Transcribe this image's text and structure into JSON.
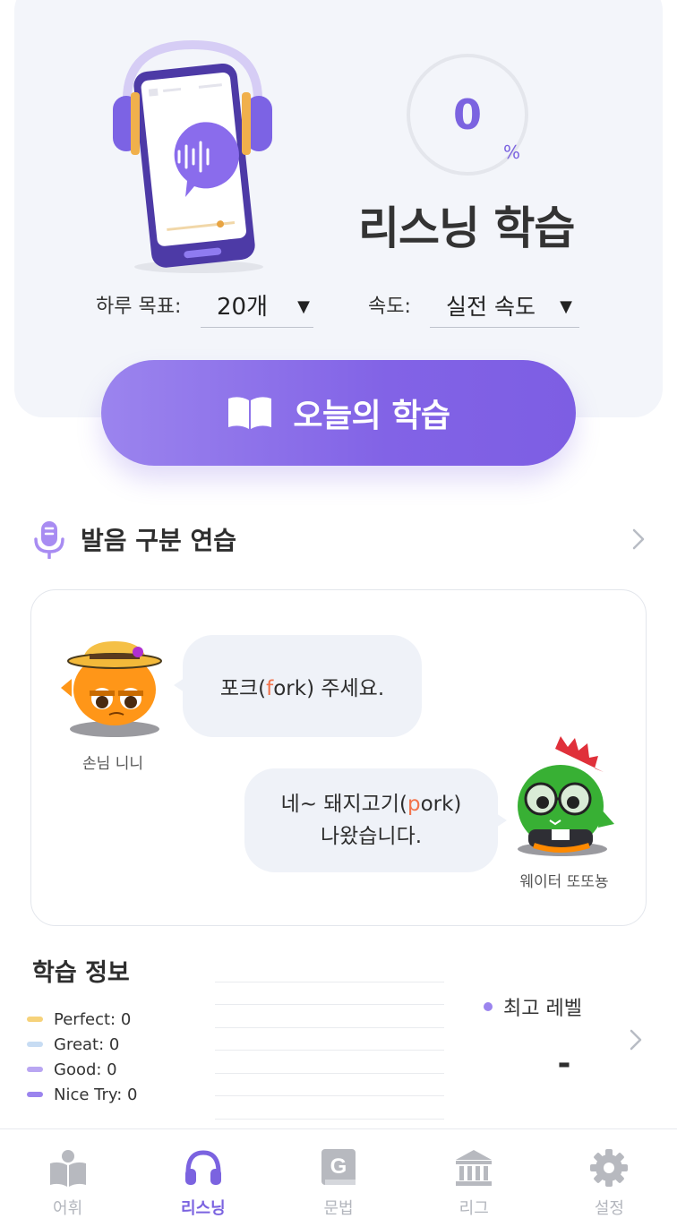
{
  "hero": {
    "progress_value": "0",
    "progress_unit": "%",
    "progress_fraction": 0,
    "title": "리스닝 학습",
    "daily_goal_label": "하루 목표:",
    "daily_goal_value": "20개",
    "speed_label": "속도:",
    "speed_value": "실전 속도",
    "dropdown_arrow": "▼"
  },
  "today_button": {
    "label": "오늘의 학습",
    "icon": "book-icon"
  },
  "pronunciation": {
    "title": "발음 구분 연습",
    "icon": "microphone-icon",
    "dialog": [
      {
        "speaker": "손님 니니",
        "text_pre": "포크(",
        "text_hl": "f",
        "text_post": "ork) 주세요."
      },
      {
        "speaker": "웨이터 또또뇽",
        "line1_pre": "네~ 돼지고기(",
        "line1_hl": "p",
        "line1_post": "ork)",
        "line2": "나왔습니다."
      }
    ],
    "highlight_color": "#f2734b"
  },
  "learning_info": {
    "title": "학습 정보",
    "legend": [
      {
        "label": "Perfect: 0",
        "color": "#f6d27a"
      },
      {
        "label": "Great: 0",
        "color": "#c7dcf3"
      },
      {
        "label": "Good: 0",
        "color": "#b9a6f2"
      },
      {
        "label": "Nice Try: 0",
        "color": "#9b84ee"
      }
    ],
    "best_level_label": "최고 레벨",
    "best_level_value": "-"
  },
  "bottom_nav": [
    {
      "label": "어휘",
      "icon": "vocabulary-book-icon",
      "active": false
    },
    {
      "label": "리스닝",
      "icon": "headphones-icon",
      "active": true
    },
    {
      "label": "문법",
      "icon": "grammar-g-icon",
      "active": false
    },
    {
      "label": "리그",
      "icon": "league-building-icon",
      "active": false
    },
    {
      "label": "설정",
      "icon": "settings-gear-icon",
      "active": false
    }
  ],
  "colors": {
    "accent": "#7b63e0",
    "inactive": "#b3b6bd",
    "hero_bg": "#f3f5fa"
  }
}
